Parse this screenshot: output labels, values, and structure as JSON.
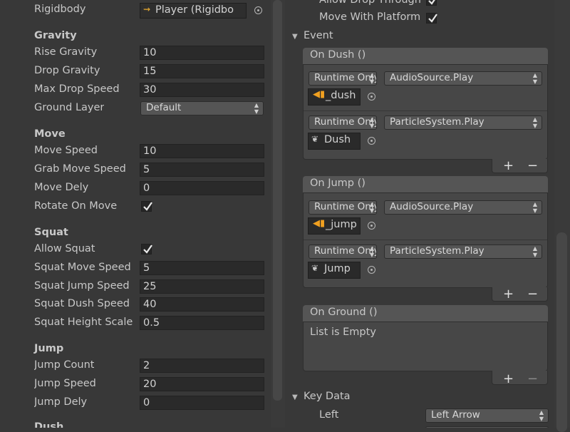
{
  "left": {
    "rigidbody": {
      "label": "Rigidbody",
      "value": "Player (Rigidbo"
    },
    "gravity": {
      "header": "Gravity",
      "fields": [
        {
          "label": "Rise Gravity",
          "value": "10"
        },
        {
          "label": "Drop Gravity",
          "value": "15"
        },
        {
          "label": "Max Drop Speed",
          "value": "30"
        }
      ],
      "ground_layer": {
        "label": "Ground Layer",
        "value": "Default"
      }
    },
    "move": {
      "header": "Move",
      "fields": [
        {
          "label": "Move Speed",
          "value": "10"
        },
        {
          "label": "Grab Move Speed",
          "value": "5"
        },
        {
          "label": "Move Dely",
          "value": "0"
        }
      ],
      "rotate_on_move": {
        "label": "Rotate On Move",
        "checked": true
      }
    },
    "squat": {
      "header": "Squat",
      "allow_squat": {
        "label": "Allow Squat",
        "checked": true
      },
      "fields": [
        {
          "label": "Squat Move Speed",
          "value": "5"
        },
        {
          "label": "Squat Jump Speed",
          "value": "25"
        },
        {
          "label": "Squat Dush Speed",
          "value": "40"
        },
        {
          "label": "Squat Height Scale",
          "value": "0.5"
        }
      ]
    },
    "jump": {
      "header": "Jump",
      "fields": [
        {
          "label": "Jump Count",
          "value": "2"
        },
        {
          "label": "Jump Speed",
          "value": "20"
        },
        {
          "label": "Jump Dely",
          "value": "0"
        }
      ]
    },
    "next_header": "Dush"
  },
  "right": {
    "allow_drop_through": {
      "label": "Allow Drop Through",
      "checked": true
    },
    "move_with_platform": {
      "label": "Move With Platform",
      "checked": true
    },
    "event_header": "Event",
    "on_dush": {
      "title": "On Dush ()",
      "rows": [
        {
          "runtime": "Runtime Only",
          "function": "AudioSource.Play",
          "object": "_dush",
          "icon": "audio-source-icon"
        },
        {
          "runtime": "Runtime Only",
          "function": "ParticleSystem.Play",
          "object": "Dush",
          "icon": "particle-system-icon"
        }
      ]
    },
    "on_jump": {
      "title": "On Jump ()",
      "rows": [
        {
          "runtime": "Runtime Only",
          "function": "AudioSource.Play",
          "object": "_jump",
          "icon": "audio-source-icon"
        },
        {
          "runtime": "Runtime Only",
          "function": "ParticleSystem.Play",
          "object": "Jump",
          "icon": "particle-system-icon"
        }
      ]
    },
    "on_ground": {
      "title": "On Ground ()",
      "empty_text": "List is Empty"
    },
    "plus_label": "+",
    "minus_label": "−",
    "key_data": {
      "header": "Key Data",
      "left": {
        "label": "Left",
        "value": "Left Arrow"
      }
    }
  },
  "colors": {
    "background": "#383838",
    "field": "#2a2a2a",
    "section": "#474747",
    "audio_icon": "#f0a020"
  }
}
